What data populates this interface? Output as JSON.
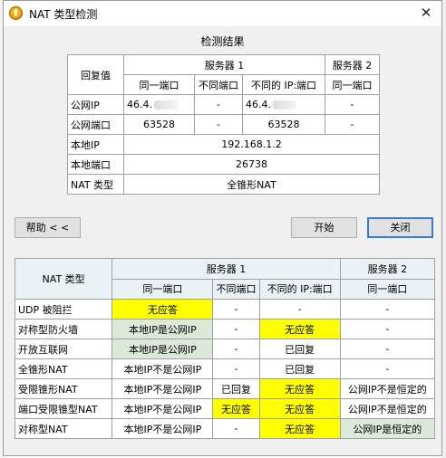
{
  "window": {
    "title": "NAT 类型检测",
    "close_glyph": "✕"
  },
  "result": {
    "title": "检测结果",
    "head": {
      "reply": "回复值",
      "server1": "服务器 1",
      "server2": "服务器 2",
      "same_port": "同一端口",
      "diff_port": "不同端口",
      "diff_ip_port": "不同的 IP:端口",
      "same_port2": "同一端口"
    },
    "rows": [
      {
        "label": "公网IP",
        "v1": "46.4.",
        "v2": "-",
        "v3": "46.4.",
        "v4": "-"
      },
      {
        "label": "公网端口",
        "v1": "63528",
        "v2": "-",
        "v3": "63528",
        "v4": "-"
      }
    ],
    "local_ip_label": "本地IP",
    "local_ip": "192.168.1.2",
    "local_port_label": "本地端口",
    "local_port": "26738",
    "nat_type_label": "NAT 类型",
    "nat_type": "全锥形NAT"
  },
  "buttons": {
    "help": "帮助 < <",
    "start": "开始",
    "close": "关闭"
  },
  "reference": {
    "head": {
      "nat_type": "NAT 类型",
      "server1": "服务器 1",
      "server2": "服务器 2",
      "same_port": "同一端口",
      "diff_port": "不同端口",
      "diff_ip_port": "不同的 IP:端口",
      "same_port2": "同一端口"
    },
    "rows": [
      {
        "name": "UDP 被阻拦",
        "c1": "无应答",
        "c2": "-",
        "c3": "-",
        "c4": "-"
      },
      {
        "name": "对称型防火墙",
        "c1": "本地IP是公网IP",
        "c2": "-",
        "c3": "无应答",
        "c4": "-"
      },
      {
        "name": "开放互联网",
        "c1": "本地IP是公网IP",
        "c2": "-",
        "c3": "已回复",
        "c4": "-"
      },
      {
        "name": "全锥形NAT",
        "c1": "本地IP不是公网IP",
        "c2": "-",
        "c3": "已回复",
        "c4": "-"
      },
      {
        "name": "受限锥形NAT",
        "c1": "本地IP不是公网IP",
        "c2": "已回复",
        "c3": "无应答",
        "c4": "公网IP不是恒定的"
      },
      {
        "name": "端口受限锥型NAT",
        "c1": "本地IP不是公网IP",
        "c2": "无应答",
        "c3": "无应答",
        "c4": "公网IP不是恒定的"
      },
      {
        "name": "对称型NAT",
        "c1": "本地IP不是公网IP",
        "c2": "-",
        "c3": "无应答",
        "c4": "公网IP是恒定的"
      }
    ]
  },
  "colors": {
    "highlight_yellow": "#ffff00",
    "highlight_green": "#dbe9d8",
    "header_blue": "#e9f3f6",
    "accent": "#3a7bd5"
  }
}
